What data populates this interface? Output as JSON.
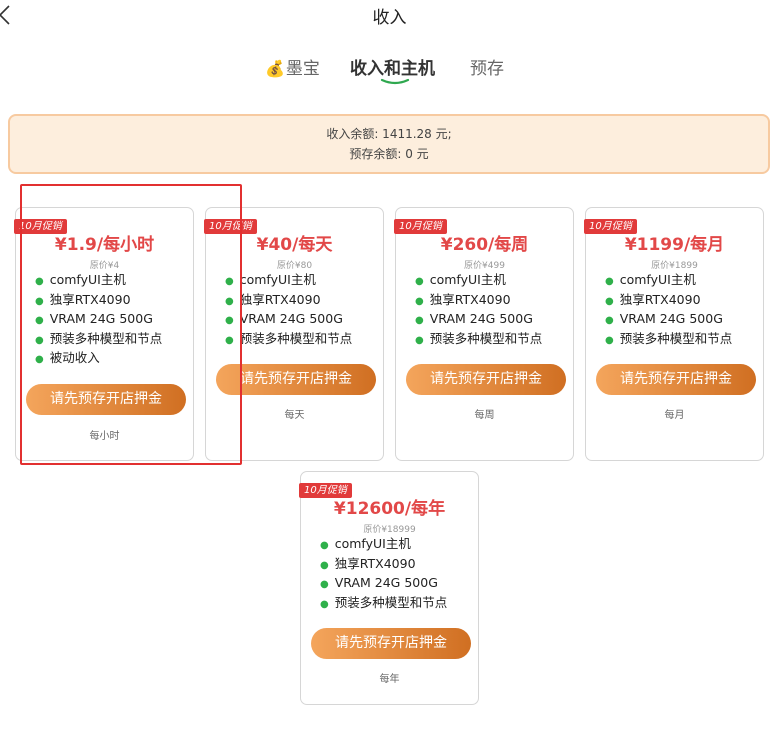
{
  "header": {
    "title": "收入"
  },
  "tabs": [
    {
      "label": "墨宝",
      "icon": "money-bag-icon"
    },
    {
      "label": "收入和主机",
      "active": true
    },
    {
      "label": "预存"
    }
  ],
  "balance": {
    "income_line": "收入余额: 1411.28 元;",
    "deposit_line": "预存余额: 0 元"
  },
  "colors": {
    "price": "#e24848",
    "promo_badge": "#e13a3a",
    "button_gradient_start": "#f4a55c",
    "button_gradient_end": "#d06f22",
    "tab_underline": "#2fa84f",
    "highlight_border": "#e23030"
  },
  "plans": [
    {
      "badge": "10月促销",
      "price": "¥1.9/每小时",
      "original": "原价¥4",
      "features": [
        "comfyUI主机",
        "独享RTX4090",
        "VRAM 24G 500G",
        "预装多种模型和节点",
        "被动收入"
      ],
      "button": "请先预存开店押金",
      "period": "每小时"
    },
    {
      "badge": "10月促销",
      "price": "¥40/每天",
      "original": "原价¥80",
      "features": [
        "comfyUI主机",
        "独享RTX4090",
        "VRAM 24G 500G",
        "预装多种模型和节点"
      ],
      "button": "请先预存开店押金",
      "period": "每天"
    },
    {
      "badge": "10月促销",
      "price": "¥260/每周",
      "original": "原价¥499",
      "features": [
        "comfyUI主机",
        "独享RTX4090",
        "VRAM 24G 500G",
        "预装多种模型和节点"
      ],
      "button": "请先预存开店押金",
      "period": "每周"
    },
    {
      "badge": "10月促销",
      "price": "¥1199/每月",
      "original": "原价¥1899",
      "features": [
        "comfyUI主机",
        "独享RTX4090",
        "VRAM 24G 500G",
        "预装多种模型和节点"
      ],
      "button": "请先预存开店押金",
      "period": "每月"
    },
    {
      "badge": "10月促销",
      "price": "¥12600/每年",
      "original": "原价¥18999",
      "features": [
        "comfyUI主机",
        "独享RTX4090",
        "VRAM 24G 500G",
        "预装多种模型和节点"
      ],
      "button": "请先预存开店押金",
      "period": "每年"
    }
  ]
}
